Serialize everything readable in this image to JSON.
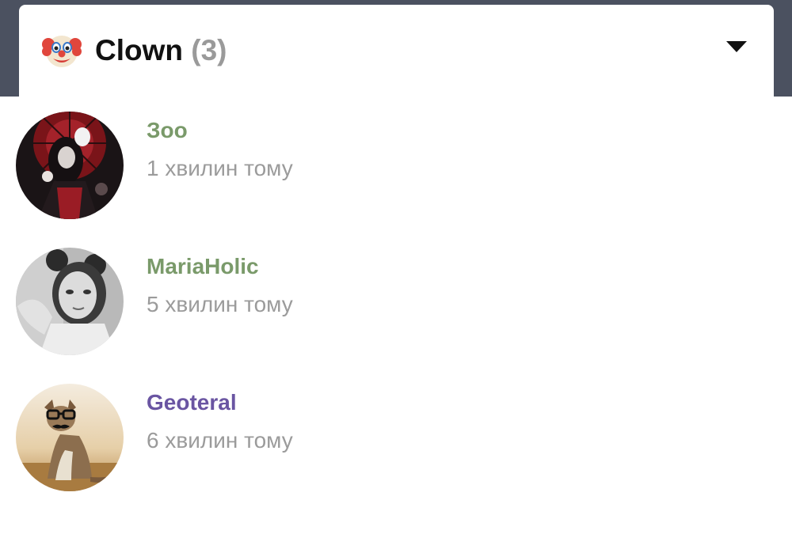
{
  "reaction": {
    "emoji_icon": "clown-face-icon",
    "title": "Clown",
    "count": "(3)",
    "toggle_icon": "triangle-down-icon"
  },
  "users": [
    {
      "name": "Зоо",
      "time": "1 хвилин тому",
      "name_color": "#7a9a6a",
      "avatar_icon": "dark-anime-girl-avatar"
    },
    {
      "name": "MariaHolic",
      "time": "5 хвилин тому",
      "name_color": "#7a9a6a",
      "avatar_icon": "grayscale-girl-avatar"
    },
    {
      "name": "Geoteral",
      "time": "6 хвилин тому",
      "name_color": "#6a55a2",
      "avatar_icon": "fox-with-glasses-avatar"
    }
  ],
  "colors": {
    "header_backdrop": "#4b5160",
    "timestamp": "#9b9b9b",
    "count": "#9a9a9a"
  }
}
